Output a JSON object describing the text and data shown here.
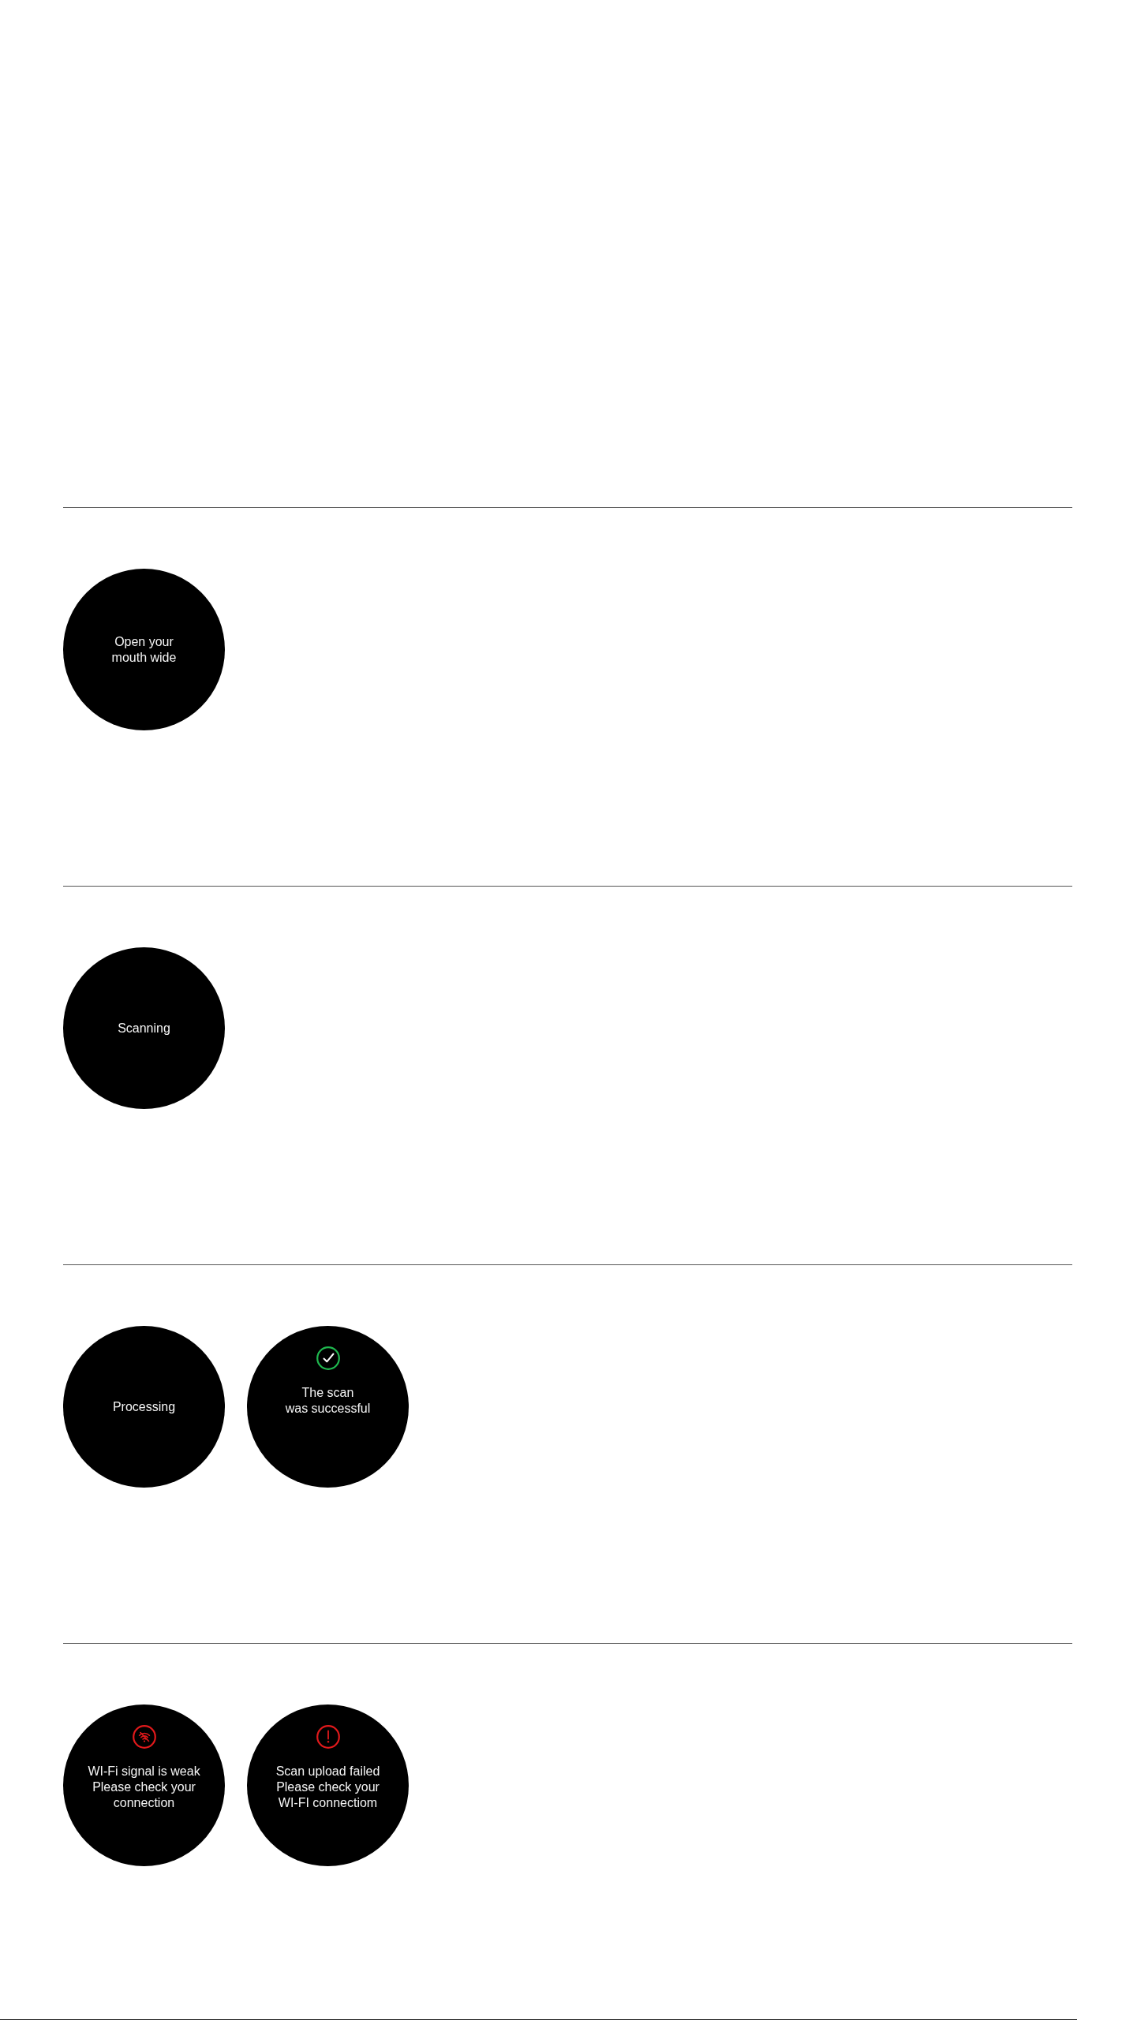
{
  "sections": [
    {
      "screens": [
        {
          "kind": "plain",
          "message": "Open your\nmouth wide"
        }
      ]
    },
    {
      "screens": [
        {
          "kind": "plain",
          "message": "Scanning"
        }
      ]
    },
    {
      "screens": [
        {
          "kind": "plain",
          "message": "Processing"
        },
        {
          "kind": "success",
          "message": "The scan\nwas successful"
        }
      ]
    },
    {
      "screens": [
        {
          "kind": "warning",
          "message": "WI-Fi signal is weak\nPlease check your\nconnection"
        },
        {
          "kind": "error",
          "message": "Scan upload failed\nPlease check your\nWI-FI connectiom"
        }
      ]
    }
  ]
}
